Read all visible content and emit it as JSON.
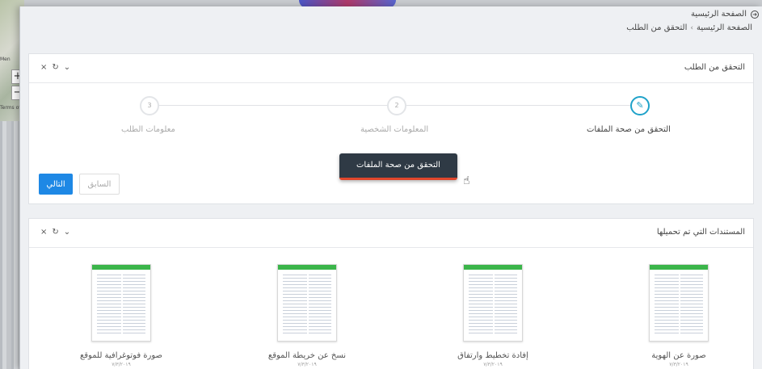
{
  "background": {
    "map_text": "Men",
    "map_zoom_in": "+",
    "map_zoom_out": "−",
    "map_attribution": "Terms of"
  },
  "breadcrumb": {
    "home": "الصفحة الرئيسية",
    "items": [
      "الصفحة الرئيسية",
      "التحقق من الطلب"
    ],
    "separator": "›"
  },
  "request_panel": {
    "title": "التحقق من الطلب",
    "tools": {
      "close": "×",
      "refresh": "↻",
      "collapse": "⌄"
    },
    "steps": [
      {
        "number": "✎",
        "label": "التحقق من صحة الملفات",
        "active": true
      },
      {
        "number": "2",
        "label": "المعلومات الشخصية",
        "active": false
      },
      {
        "number": "3",
        "label": "معلومات الطلب",
        "active": false
      }
    ],
    "next_label": "التالي",
    "prev_label": "السابق",
    "tooltip": "التحقق من صحة الملفات"
  },
  "documents_panel": {
    "title": "المستندات التي تم تحميلها",
    "tools": {
      "close": "×",
      "refresh": "↻",
      "collapse": "⌄"
    },
    "documents": [
      {
        "name": "صورة عن الهوية",
        "date": "٧/٣/٢٠١٩"
      },
      {
        "name": "إفادة تخطيط وارتفاق",
        "date": "٧/٣/٢٠١٩"
      },
      {
        "name": "نسخ عن خريطة الموقع",
        "date": "٧/٣/٢٠١٩"
      },
      {
        "name": "صورة فوتوغرافية للموقع",
        "date": "٧/٣/٢٠١٩"
      }
    ]
  },
  "colors": {
    "accent": "#1e88e5",
    "step_active": "#1fa2c9",
    "tooltip_bg": "#2f3a45",
    "tooltip_border": "#e0462c",
    "doc_header": "#3bb54a"
  }
}
